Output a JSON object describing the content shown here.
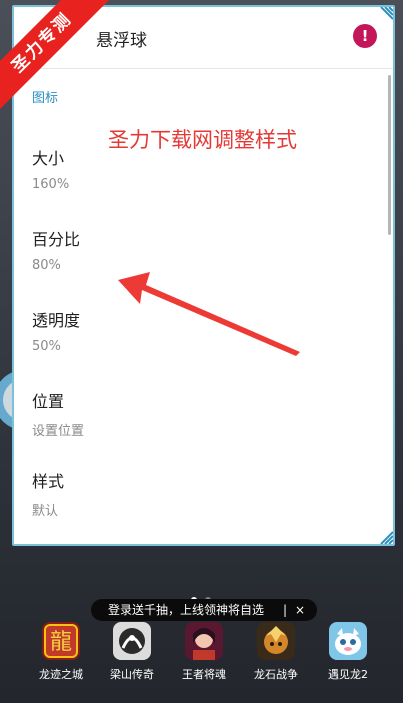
{
  "watermark": {
    "text": "圣力专测"
  },
  "panel": {
    "title": "悬浮球",
    "section_label": "图标",
    "annotation": "圣力下载网调整样式",
    "settings": [
      {
        "title": "大小",
        "value": "160%"
      },
      {
        "title": "百分比",
        "value": "80%"
      },
      {
        "title": "透明度",
        "value": "50%"
      },
      {
        "title": "位置",
        "value": "设置位置"
      },
      {
        "title": "样式",
        "value": "默认"
      }
    ]
  },
  "toast": {
    "text": "登录送千抽，上线领神将自选",
    "close": "×"
  },
  "dock": {
    "apps": [
      {
        "label": "龙迹之城",
        "icon": "longji-game-icon"
      },
      {
        "label": "梁山传奇",
        "icon": "liangshan-game-icon"
      },
      {
        "label": "王者将魂",
        "icon": "wangzhe-game-icon"
      },
      {
        "label": "龙石战争",
        "icon": "longshi-game-icon"
      },
      {
        "label": "遇见龙2",
        "icon": "yujianlong-game-icon"
      }
    ]
  },
  "colors": {
    "accent": "#2a8fbf",
    "annotation": "#e53935",
    "border": "#7ac2d8",
    "alert": "#c2185b",
    "ribbon": "#e8231f"
  }
}
